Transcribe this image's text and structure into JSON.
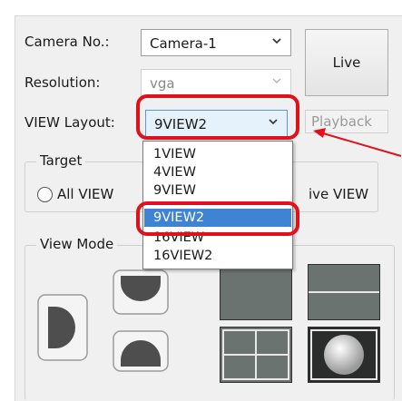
{
  "form": {
    "camera_no_label": "Camera No.:",
    "camera_value": "Camera-1",
    "resolution_label": "Resolution:",
    "resolution_value": "vga",
    "view_layout_label": "VIEW Layout:",
    "view_layout_value": "9VIEW2"
  },
  "buttons": {
    "live": "Live",
    "playback": "Playback"
  },
  "target_group": {
    "title": "Target",
    "option_all": "All VIEW",
    "option_active_partial": "ive VIEW"
  },
  "view_mode_group": {
    "title": "View Mode"
  },
  "dropdown": {
    "options": [
      "1VIEW",
      "4VIEW",
      "9VIEW",
      "9VIEW2",
      "16VIEW",
      "16VIEW2"
    ],
    "selected": "9VIEW2"
  },
  "colors": {
    "accent_highlight": "#e0111b",
    "selection": "#3f83d4"
  }
}
